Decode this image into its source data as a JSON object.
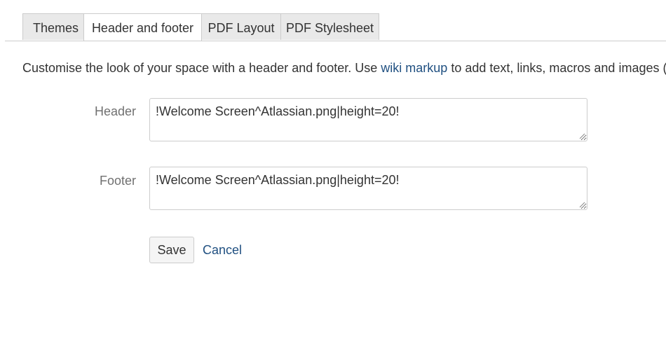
{
  "tabs": [
    {
      "label": "Themes",
      "active": false
    },
    {
      "label": "Header and footer",
      "active": true
    },
    {
      "label": "PDF Layout",
      "active": false
    },
    {
      "label": "PDF Stylesheet",
      "active": false
    }
  ],
  "description": {
    "before_link": "Customise the look of your space with a header and footer. Use ",
    "link_text": "wiki markup",
    "after_link": " to add text, links, macros and images (from"
  },
  "form": {
    "header": {
      "label": "Header",
      "value": "!Welcome Screen^Atlassian.png|height=20!"
    },
    "footer": {
      "label": "Footer",
      "value": "!Welcome Screen^Atlassian.png|height=20!"
    },
    "save_label": "Save",
    "cancel_label": "Cancel"
  },
  "colors": {
    "link": "#205081",
    "tab_inactive_bg": "#e9e9e9",
    "border": "#cccccc"
  }
}
